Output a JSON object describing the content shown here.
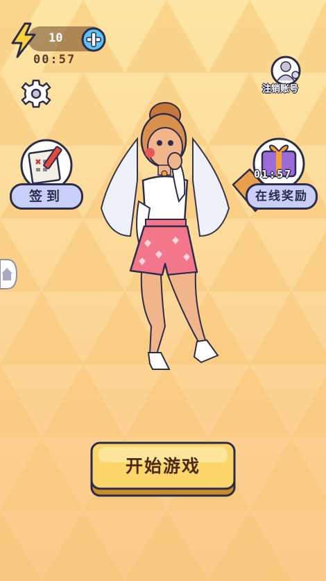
{
  "hud": {
    "energy_count": "10",
    "energy_timer": "00:57"
  },
  "buttons": {
    "logout_label": "注销账号",
    "checkin_label": "签到",
    "online_reward_label": "在线奖励",
    "online_reward_timer": "01:57",
    "start_label": "开始游戏"
  },
  "icons": {
    "energy": "lightning-icon",
    "add": "plus-icon",
    "settings": "gear-icon",
    "account": "user-avatar-icon",
    "checkin": "calendar-pen-icon",
    "reward": "gift-box-icon",
    "side_tab": "house-icon"
  },
  "colors": {
    "background_light": "#fde4a3",
    "background_dark": "#f8c47a",
    "button_yellow": "#fbd66b",
    "pill_blue": "#c9cff8",
    "outline": "#2b2b4a"
  }
}
